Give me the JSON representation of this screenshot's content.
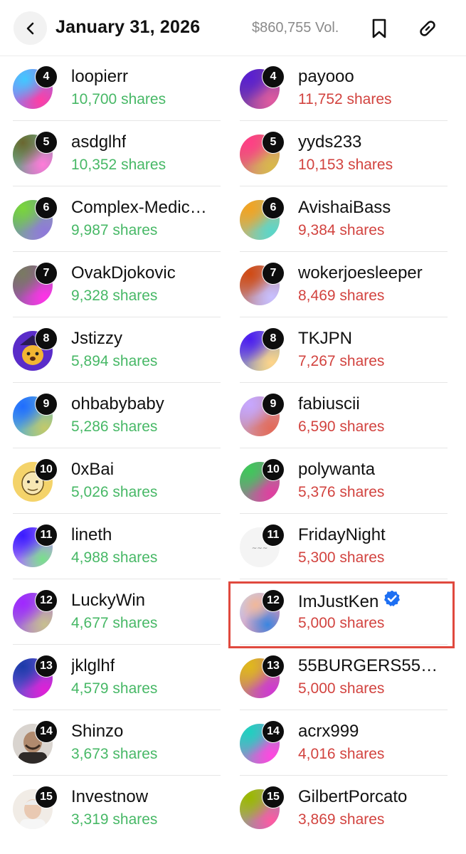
{
  "header": {
    "back_icon": "chevron-left-icon",
    "title": "January 31, 2026",
    "volume": "$860,755 Vol.",
    "bookmark_icon": "bookmark-icon",
    "link_icon": "link-icon"
  },
  "colors": {
    "buy": "#47b866",
    "sell": "#d2433f",
    "highlight": "#e0493e",
    "verified": "#1d6ff2"
  },
  "holders": {
    "yes": [
      {
        "rank": "4",
        "name": "loopierr",
        "shares": "10,700 shares"
      },
      {
        "rank": "5",
        "name": "asdglhf",
        "shares": "10,352 shares"
      },
      {
        "rank": "6",
        "name": "Complex-Medic…",
        "shares": "9,987 shares"
      },
      {
        "rank": "7",
        "name": "OvakDjokovic",
        "shares": "9,328 shares"
      },
      {
        "rank": "8",
        "name": "Jstizzy",
        "shares": "5,894 shares"
      },
      {
        "rank": "9",
        "name": "ohbabybaby",
        "shares": "5,286 shares"
      },
      {
        "rank": "10",
        "name": "0xBai",
        "shares": "5,026 shares"
      },
      {
        "rank": "11",
        "name": "lineth",
        "shares": "4,988 shares"
      },
      {
        "rank": "12",
        "name": "LuckyWin",
        "shares": "4,677 shares"
      },
      {
        "rank": "13",
        "name": "jklglhf",
        "shares": "4,579 shares"
      },
      {
        "rank": "14",
        "name": "Shinzo",
        "shares": "3,673 shares"
      },
      {
        "rank": "15",
        "name": "Investnow",
        "shares": "3,319 shares"
      }
    ],
    "no": [
      {
        "rank": "4",
        "name": "payooo",
        "shares": "11,752 shares"
      },
      {
        "rank": "5",
        "name": "yyds233",
        "shares": "10,153 shares"
      },
      {
        "rank": "6",
        "name": "AvishaiBass",
        "shares": "9,384 shares"
      },
      {
        "rank": "7",
        "name": "wokerjoesleeper",
        "shares": "8,469 shares"
      },
      {
        "rank": "8",
        "name": "TKJPN",
        "shares": "7,267 shares"
      },
      {
        "rank": "9",
        "name": "fabiuscii",
        "shares": "6,590 shares"
      },
      {
        "rank": "10",
        "name": "polywanta",
        "shares": "5,376 shares"
      },
      {
        "rank": "11",
        "name": "FridayNight",
        "shares": "5,300 shares"
      },
      {
        "rank": "12",
        "name": "ImJustKen",
        "shares": "5,000 shares",
        "verified": true
      },
      {
        "rank": "13",
        "name": "55BURGERS55…",
        "shares": "5,000 shares"
      },
      {
        "rank": "14",
        "name": "acrx999",
        "shares": "4,016 shares"
      },
      {
        "rank": "15",
        "name": "GilbertPorcato",
        "shares": "3,869 shares"
      }
    ]
  }
}
